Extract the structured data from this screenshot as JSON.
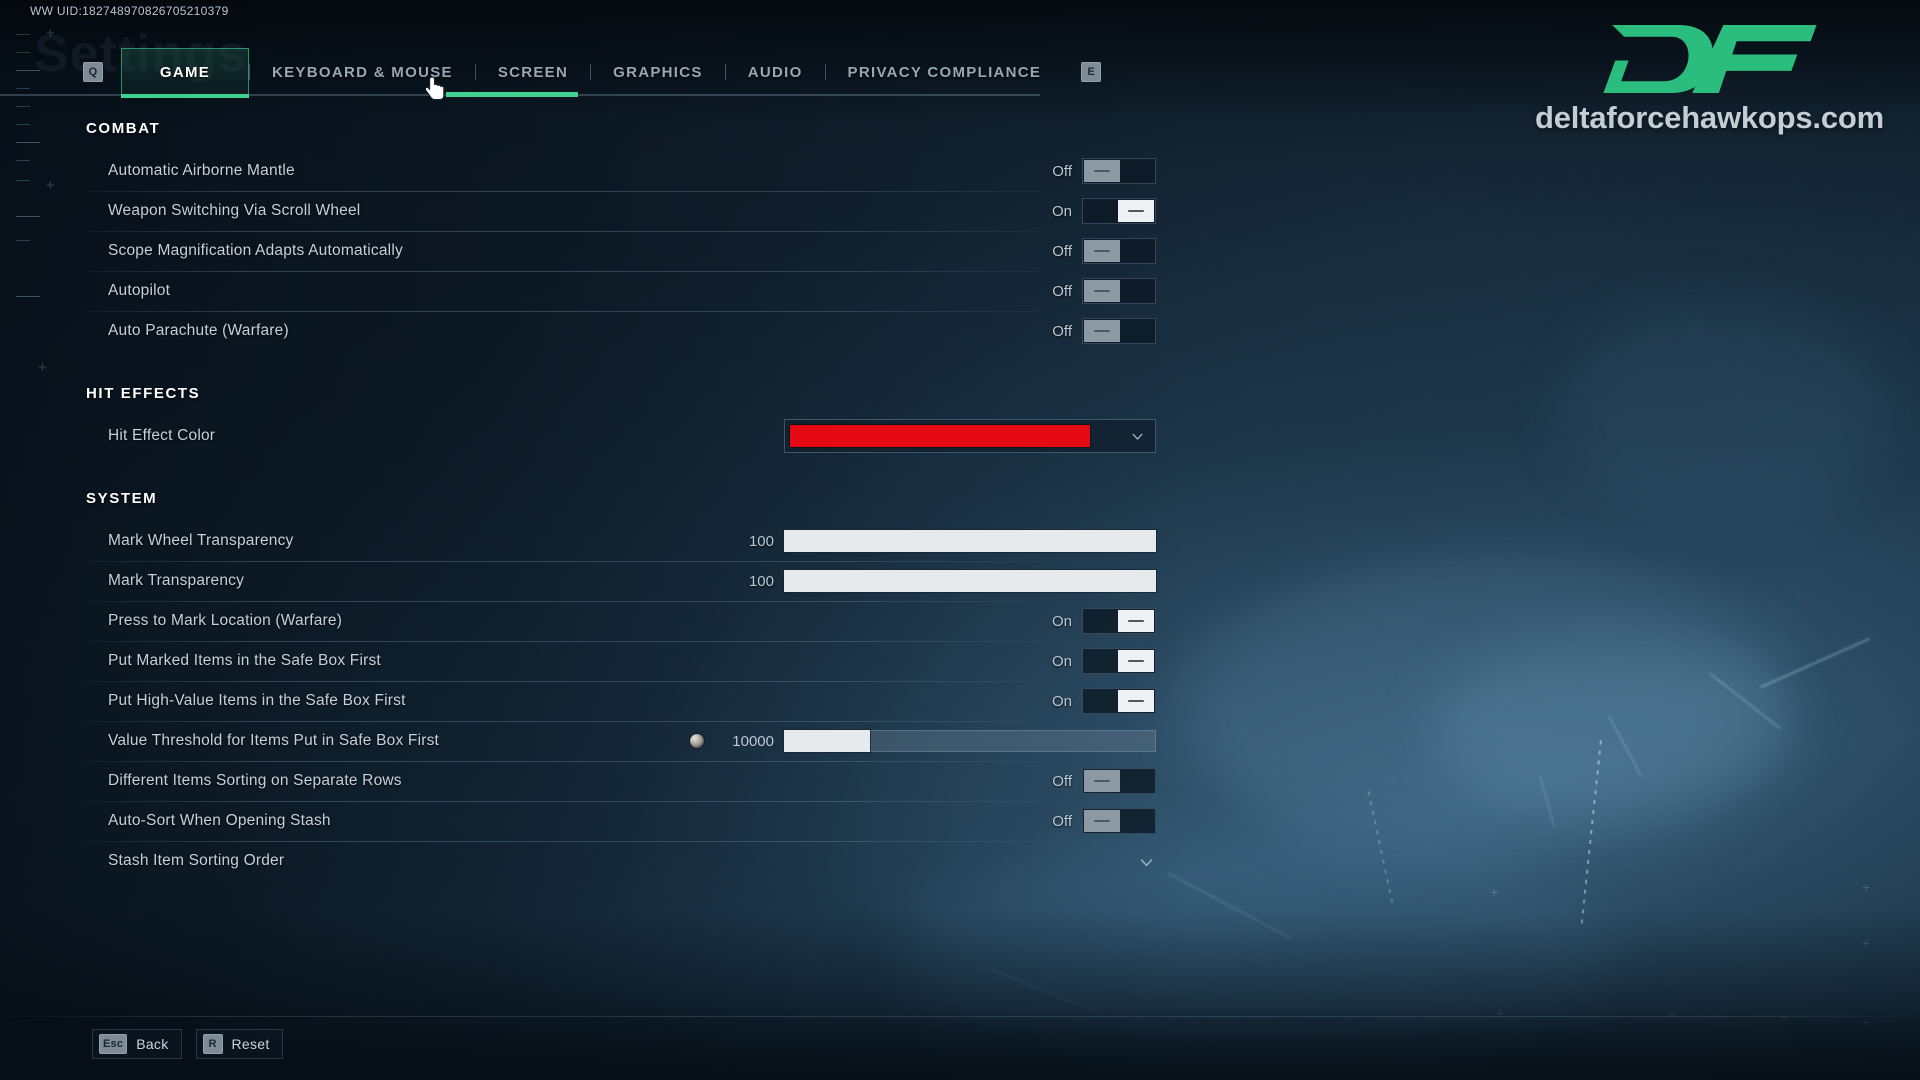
{
  "app": {
    "uid_text": "WW UID:182748970826705210379",
    "ghost_title": "Settings"
  },
  "tabbar": {
    "prev_key": "Q",
    "next_key": "E",
    "tabs": [
      {
        "label": "GAME",
        "active": true
      },
      {
        "label": "KEYBOARD & MOUSE",
        "active": false
      },
      {
        "label": "SCREEN",
        "active": false
      },
      {
        "label": "GRAPHICS",
        "active": false
      },
      {
        "label": "AUDIO",
        "active": false
      },
      {
        "label": "PRIVACY COMPLIANCE",
        "active": false
      }
    ]
  },
  "sections": [
    {
      "title": "COMBAT",
      "rows": [
        {
          "label": "Automatic Airborne Mantle",
          "value": "Off",
          "control": "toggle",
          "state": "off"
        },
        {
          "label": "Weapon Switching Via Scroll Wheel",
          "value": "On",
          "control": "toggle",
          "state": "on"
        },
        {
          "label": "Scope Magnification Adapts Automatically",
          "value": "Off",
          "control": "toggle",
          "state": "off"
        },
        {
          "label": "Autopilot",
          "value": "Off",
          "control": "toggle",
          "state": "off"
        },
        {
          "label": "Auto Parachute (Warfare)",
          "value": "Off",
          "control": "toggle",
          "state": "off"
        }
      ]
    },
    {
      "title": "HIT EFFECTS",
      "rows": [
        {
          "label": "Hit Effect Color",
          "value": "",
          "control": "color",
          "color": "#E50914"
        }
      ]
    },
    {
      "title": "SYSTEM",
      "rows": [
        {
          "label": "Mark Wheel Transparency",
          "value": "100",
          "control": "slider",
          "percent": 100
        },
        {
          "label": "Mark Transparency",
          "value": "100",
          "control": "slider",
          "percent": 100
        },
        {
          "label": "Press to Mark Location (Warfare)",
          "value": "On",
          "control": "toggle",
          "state": "on"
        },
        {
          "label": "Put Marked Items in the Safe Box First",
          "value": "On",
          "control": "toggle",
          "state": "on"
        },
        {
          "label": "Put High-Value Items in the Safe Box First",
          "value": "On",
          "control": "toggle",
          "state": "on"
        },
        {
          "label": "Value Threshold for Items Put in Safe Box First",
          "value": "10000",
          "control": "slider-coin",
          "percent": 23
        },
        {
          "label": "Different Items Sorting on Separate Rows",
          "value": "Off",
          "control": "toggle",
          "state": "off"
        },
        {
          "label": "Auto-Sort When Opening Stash",
          "value": "Off",
          "control": "toggle",
          "state": "off"
        },
        {
          "label": "Stash Item Sorting Order",
          "value": "",
          "control": "dropdown"
        }
      ]
    }
  ],
  "bottombar": {
    "hints": [
      {
        "key": "Esc",
        "label": "Back"
      },
      {
        "key": "R",
        "label": "Reset"
      }
    ]
  },
  "watermark": {
    "logo_text": "DF",
    "url": "deltaforcehawkops.com",
    "brand_color": "#2BBD7E"
  },
  "colors": {
    "accent_green": "#3FD190",
    "hit_effect_red": "#E50914",
    "slider_fill": "#E6EAED",
    "panel_bg": "#132434"
  }
}
